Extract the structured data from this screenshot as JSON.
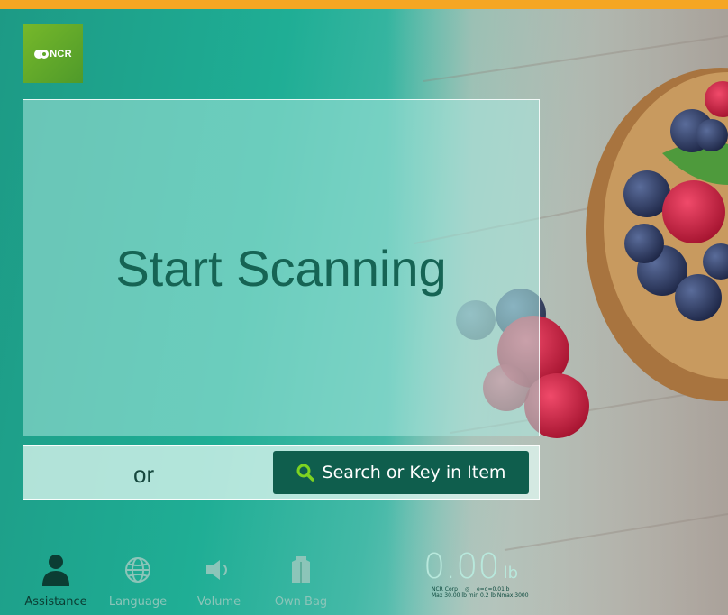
{
  "brand": {
    "logo_text": "NCR"
  },
  "main": {
    "title": "Start Scanning",
    "or_text": "or",
    "search_button_label": "Search or Key in Item"
  },
  "footer": {
    "items": [
      {
        "label": "Assistance",
        "icon": "person-icon",
        "state": "active"
      },
      {
        "label": "Language",
        "icon": "globe-icon",
        "state": "disabled"
      },
      {
        "label": "Volume",
        "icon": "speaker-icon",
        "state": "disabled"
      },
      {
        "label": "Own Bag",
        "icon": "bag-icon",
        "state": "disabled"
      }
    ]
  },
  "scale": {
    "weight": "0.00",
    "unit": "lb",
    "vendor": "NCR Corp",
    "division": "e=d=0.01lb",
    "capacity": "Max 30.00 lb min 0.2 lb  Nmax 3000"
  },
  "colors": {
    "accent_bar": "#f5a623",
    "primary_button": "#0f5e4d",
    "title_text": "#166454",
    "logo_bg": "#76b82a"
  }
}
